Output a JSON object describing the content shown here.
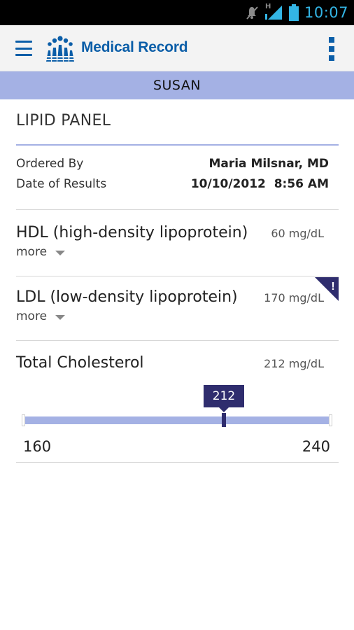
{
  "status_bar": {
    "time": "10:07",
    "network_type": "H",
    "icons": [
      "mute-icon",
      "signal-icon",
      "battery-icon"
    ],
    "time_color": "#33b5e5"
  },
  "app_bar": {
    "title": "Medical Record",
    "menu_icon": "hamburger-menu-icon",
    "overflow_icon": "overflow-menu-icon",
    "brand_color": "#0b5ea8"
  },
  "patient": {
    "name": "SUSAN",
    "banner_color": "#a4b1e4"
  },
  "panel": {
    "title": "LIPID PANEL",
    "ordered_by_label": "Ordered By",
    "ordered_by_value": "Maria Milsnar, MD",
    "date_label": "Date of Results",
    "date_value": "10/10/2012  8:56 AM"
  },
  "results": [
    {
      "name": "HDL (high-density lipoprotein)",
      "value": "60 mg/dL",
      "more_label": "more",
      "flagged": false
    },
    {
      "name": "LDL (low-density lipoprotein)",
      "value": "170 mg/dL",
      "more_label": "more",
      "flagged": true,
      "flag_symbol": "!",
      "flag_color": "#2f2d6e"
    },
    {
      "name": "Total Cholesterol",
      "value": "212 mg/dL",
      "flagged": false
    }
  ],
  "cholesterol_range": {
    "min": 160,
    "max": 240,
    "min_label": "160",
    "max_label": "240",
    "current": 212,
    "current_label": "212",
    "track_color": "#a4b1e4",
    "marker_color": "#2f2d6e"
  }
}
